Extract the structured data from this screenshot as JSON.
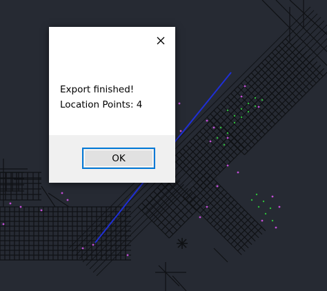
{
  "dialog": {
    "message_line1": "Export finished!",
    "message_line2": "Location Points: 4",
    "ok_label": "OK",
    "close_icon": "close-icon"
  },
  "theme": {
    "canvas_background": "#262a33",
    "road_line_color": "#0f1114",
    "route_color": "#1f2fd6",
    "vertex_magenta": "#c24dd6",
    "vertex_green": "#2fbf3a",
    "dialog_accent": "#0078d7"
  }
}
